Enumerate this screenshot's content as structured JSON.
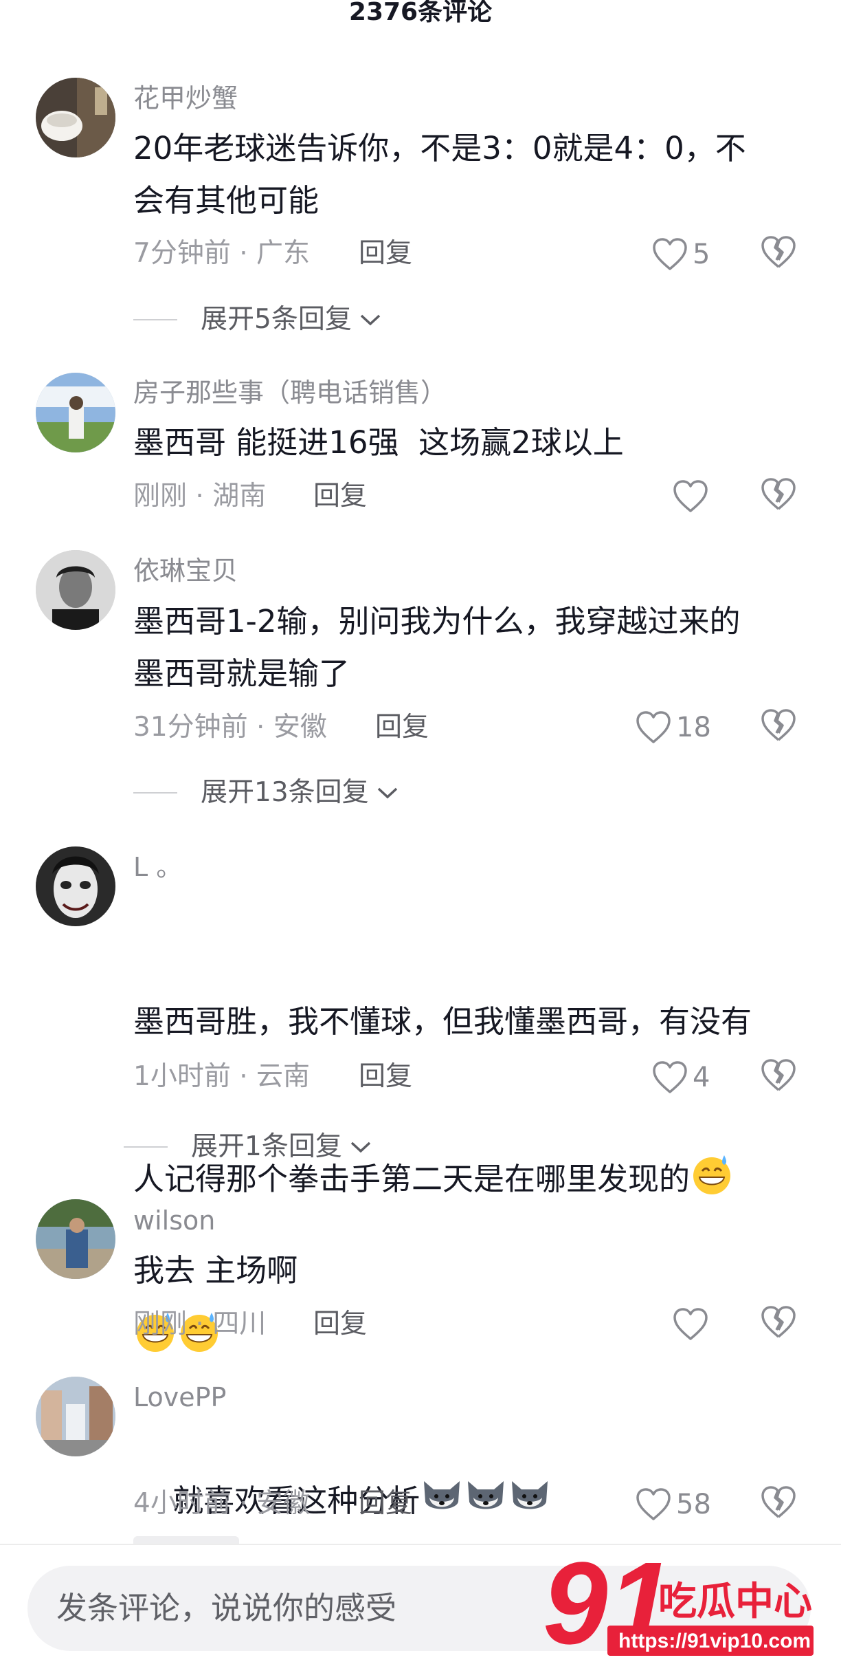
{
  "header": {
    "title": "2376条评论"
  },
  "comments": [
    {
      "user": "花甲炒蟹",
      "text": "20年老球迷告诉你，不是3：0就是4：0，不\n会有其他可能",
      "meta": "7分钟前 · 广东",
      "reply_label": "回复",
      "likes": "5",
      "expand": "展开5条回复"
    },
    {
      "user": "房子那些事（聘电话销售）",
      "text": "墨西哥 能挺进16强  这场赢2球以上",
      "meta": "刚刚 · 湖南",
      "reply_label": "回复",
      "likes": ""
    },
    {
      "user": "依琳宝贝",
      "text": "墨西哥1-2输，别问我为什么，我穿越过来的\n墨西哥就是输了",
      "meta": "31分钟前 · 安徽",
      "reply_label": "回复",
      "likes": "18",
      "expand": "展开13条回复"
    },
    {
      "user": "L 。",
      "text_line1": "墨西哥胜，我不懂球，但我懂墨西哥，有没有",
      "text_line2": "人记得那个拳击手第二天是在哪里发现的",
      "meta": "1小时前 · 云南",
      "reply_label": "回复",
      "likes": "4",
      "expand": "展开1条回复"
    },
    {
      "user": "wilson",
      "text": "我去 主场啊",
      "meta": "刚刚 · 四川",
      "reply_label": "回复",
      "likes": ""
    },
    {
      "user": "LovePP",
      "text": "就喜欢看这种分析",
      "meta": "4小时前 · 安徽",
      "reply_label": "回复",
      "likes": "58"
    }
  ],
  "icons": {
    "like": "heart-outline-icon",
    "dislike": "broken-heart-icon",
    "expand": "chevron-down-icon",
    "emoji_sweat": "grinning-sweat-emoji",
    "emoji_husky": "husky-dog-emoji"
  },
  "input": {
    "placeholder": "发条评论，说说你的感受"
  },
  "watermark": {
    "brand": "91吃瓜中心",
    "url": "https://91vip10.com"
  },
  "colors": {
    "text": "#161823",
    "meta": "#9a9ba1",
    "watermark": "#e8213a"
  }
}
